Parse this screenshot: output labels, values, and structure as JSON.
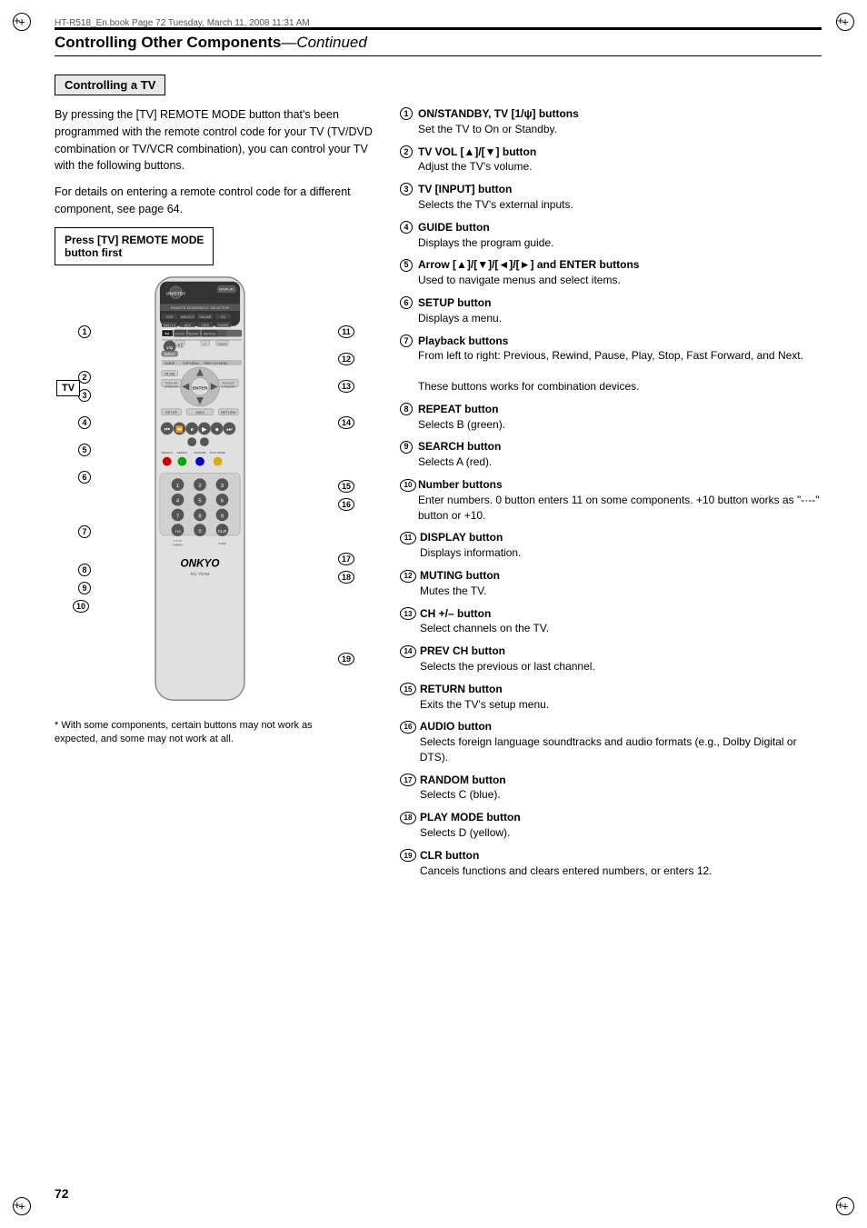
{
  "page": {
    "number": "72",
    "file_info": "HT-R518_En.book  Page 72  Tuesday, March 11, 2008  11:31 AM"
  },
  "header": {
    "title": "Controlling Other Components",
    "title_continued": "—Continued"
  },
  "section": {
    "title": "Controlling a TV"
  },
  "intro": {
    "para1": "By pressing the [TV] REMOTE MODE button that's been programmed with the remote control code for your TV (TV/DVD combination or TV/VCR combination), you can control your TV with the following buttons.",
    "para2": "For details on entering a remote control code for a different component, see page 64."
  },
  "callout": {
    "text": "Press [TV] REMOTE MODE\nbutton first"
  },
  "footnote": {
    "symbol": "*",
    "text": "With some components, certain buttons may not work as expected, and some may not work at all."
  },
  "tv_label": "TV",
  "items": [
    {
      "num": "1",
      "title": "ON/STANDBY, TV [1/ψ] buttons",
      "desc": "Set the TV to On or Standby."
    },
    {
      "num": "2",
      "title": "TV VOL [▲]/[▼] button",
      "desc": "Adjust the TV's volume."
    },
    {
      "num": "3",
      "title": "TV [INPUT] button",
      "desc": "Selects the TV's external inputs."
    },
    {
      "num": "4",
      "title": "GUIDE button",
      "desc": "Displays the program guide."
    },
    {
      "num": "5",
      "title": "Arrow [▲]/[▼]/[◄]/[►] and ENTER buttons",
      "desc": "Used to navigate menus and select items."
    },
    {
      "num": "6",
      "title": "SETUP button",
      "desc": "Displays a menu."
    },
    {
      "num": "7",
      "title": "Playback buttons",
      "desc1": "From left to right: Previous, Rewind, Pause, Play, Stop, Fast Forward, and Next.",
      "desc2": "These buttons works for combination devices."
    },
    {
      "num": "8",
      "title": "REPEAT button",
      "desc": "Selects B (green)."
    },
    {
      "num": "9",
      "title": "SEARCH button",
      "desc": "Selects A (red)."
    },
    {
      "num": "10",
      "title": "Number buttons",
      "desc": "Enter numbers. 0 button enters 11 on some components. +10 button works as \"-·--\" button or +10."
    },
    {
      "num": "11",
      "title": "DISPLAY button",
      "desc": "Displays information."
    },
    {
      "num": "12",
      "title": "MUTING button",
      "desc": "Mutes the TV."
    },
    {
      "num": "13",
      "title": "CH +/– button",
      "desc": "Select channels on the TV."
    },
    {
      "num": "14",
      "title": "PREV CH button",
      "desc": "Selects the previous or last channel."
    },
    {
      "num": "15",
      "title": "RETURN button",
      "desc": "Exits the TV's setup menu."
    },
    {
      "num": "16",
      "title": "AUDIO button",
      "desc": "Selects foreign language soundtracks and audio formats (e.g., Dolby Digital or DTS)."
    },
    {
      "num": "17",
      "title": "RANDOM button",
      "desc": "Selects C (blue)."
    },
    {
      "num": "18",
      "title": "PLAY MODE button",
      "desc": "Selects D (yellow)."
    },
    {
      "num": "19",
      "title": "CLR button",
      "desc": "Cancels functions and clears entered numbers, or enters 12."
    }
  ]
}
